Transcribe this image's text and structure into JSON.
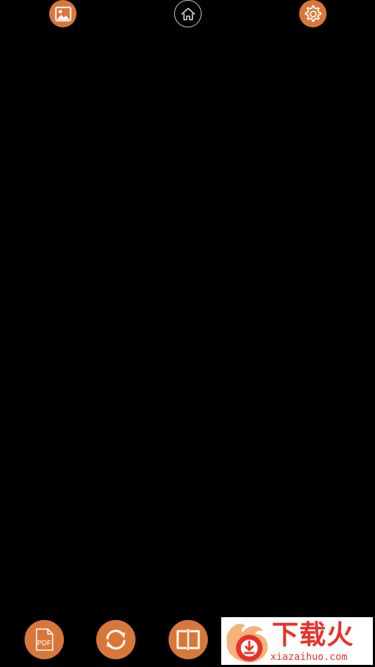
{
  "toolbar_top": {
    "gallery_icon": "image-icon",
    "home_icon": "home-icon",
    "settings_icon": "gear-icon"
  },
  "toolbar_bottom": {
    "pdf_label": "PDF",
    "pdf_icon": "pdf-file-icon",
    "rotate_icon": "refresh-icon",
    "split_icon": "split-view-icon"
  },
  "watermark": {
    "title": "下载火",
    "url": "xiazaihuo.com"
  },
  "colors": {
    "background": "#000000",
    "accent": "#d9773a",
    "watermark_red": "#e8332a"
  }
}
